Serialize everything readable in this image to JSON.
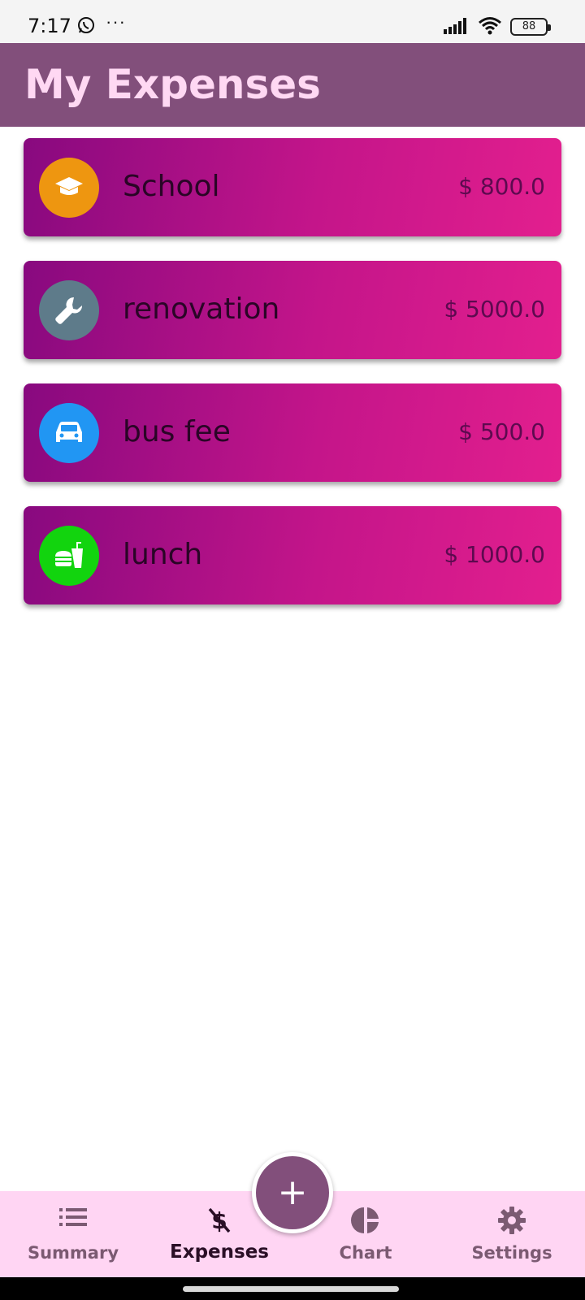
{
  "status_bar": {
    "time": "7:17",
    "more": "···",
    "battery": "88"
  },
  "app_bar": {
    "title": "My Expenses",
    "color": "#824f7b",
    "title_color": "#ffd8f3"
  },
  "expenses": [
    {
      "name": "School",
      "amount": "$ 800.0",
      "icon": "graduation-cap-icon",
      "icon_color": "#ee9610"
    },
    {
      "name": "renovation",
      "amount": "$ 5000.0",
      "icon": "wrench-icon",
      "icon_color": "#5e7b8a"
    },
    {
      "name": "bus fee",
      "amount": "$ 500.0",
      "icon": "car-icon",
      "icon_color": "#2196f3"
    },
    {
      "name": "lunch",
      "amount": "$ 1000.0",
      "icon": "fastfood-icon",
      "icon_color": "#12d40e"
    }
  ],
  "fab": {
    "label": "+"
  },
  "bottom_nav": {
    "items": [
      {
        "label": "Summary",
        "icon": "list-icon",
        "active": false
      },
      {
        "label": "Expenses",
        "icon": "money-off-icon",
        "active": true
      },
      {
        "label": "Chart",
        "icon": "pie-chart-icon",
        "active": false
      },
      {
        "label": "Settings",
        "icon": "gear-icon",
        "active": false
      }
    ],
    "background": "#ffd5f3"
  }
}
